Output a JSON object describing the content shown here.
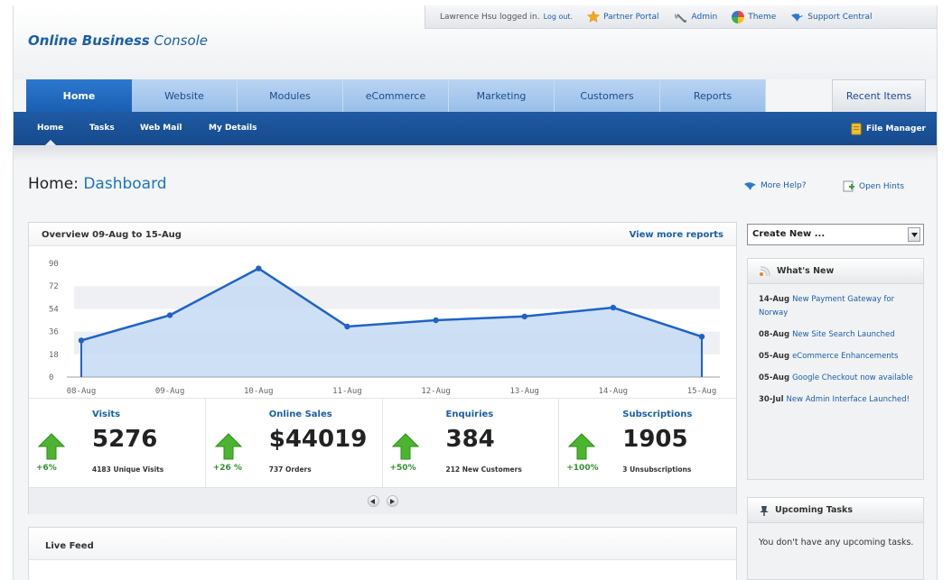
{
  "header": {
    "logo_bold": "Online Business",
    "logo_rest": "Console",
    "login_text": "Lawrence Hsu logged in.",
    "logout": "Log out.",
    "links": [
      {
        "label": "Partner Portal",
        "icon": "star-icon"
      },
      {
        "label": "Admin",
        "icon": "wrench-icon"
      },
      {
        "label": "Theme",
        "icon": "color-wheel-icon"
      },
      {
        "label": "Support Central",
        "icon": "support-bird-icon"
      }
    ]
  },
  "nav": {
    "tabs": [
      "Home",
      "Website",
      "Modules",
      "eCommerce",
      "Marketing",
      "Customers",
      "Reports"
    ],
    "active": "Home",
    "recent_items": "Recent Items"
  },
  "subnav": {
    "items": [
      "Home",
      "Tasks",
      "Web Mail",
      "My Details"
    ],
    "active": "Home",
    "file_manager": "File Manager"
  },
  "page": {
    "title_prefix": "Home:",
    "title": "Dashboard",
    "more_help": "More Help?",
    "open_hints": "Open Hints"
  },
  "overview": {
    "title": "Overview 09-Aug to 15-Aug",
    "more_link": "View more reports"
  },
  "chart_data": {
    "type": "area",
    "x": [
      "08-Aug",
      "09-Aug",
      "10-Aug",
      "11-Aug",
      "12-Aug",
      "13-Aug",
      "14-Aug",
      "15-Aug"
    ],
    "y_ticks": [
      0,
      18,
      36,
      54,
      72,
      90
    ],
    "ylim": [
      0,
      90
    ],
    "series": [
      {
        "values": [
          29,
          49,
          86,
          40,
          45,
          48,
          55,
          32
        ]
      }
    ],
    "grid": "alternating horizontal bands",
    "colors": {
      "line": "#1f63c7",
      "fill": "#c6dbf3"
    }
  },
  "stats": [
    {
      "label": "Visits",
      "value": "5276",
      "change": "+6%",
      "sub": "4183 Unique Visits"
    },
    {
      "label": "Online Sales",
      "value": "$44019",
      "change": "+26 %",
      "sub": "737 Orders"
    },
    {
      "label": "Enquiries",
      "value": "384",
      "change": "+50%",
      "sub": "212 New Customers"
    },
    {
      "label": "Subscriptions",
      "value": "1905",
      "change": "+100%",
      "sub": "3 Unsubscriptions"
    }
  ],
  "live_feed": {
    "title": "Live Feed"
  },
  "sidebar": {
    "create_new": "Create New ...",
    "whats_new": {
      "title": "What's New",
      "items": [
        {
          "date": "14-Aug",
          "text": "New Payment Gateway for Norway"
        },
        {
          "date": "08-Aug",
          "text": "New Site Search Launched"
        },
        {
          "date": "05-Aug",
          "text": "eCommerce Enhancements"
        },
        {
          "date": "05-Aug",
          "text": "Google Checkout now available"
        },
        {
          "date": "30-Jul",
          "text": "New Admin Interface Launched!"
        }
      ]
    },
    "tasks": {
      "title": "Upcoming Tasks",
      "empty": "You don't have any upcoming tasks."
    }
  },
  "colors": {
    "brand_blue": "#1b5fa6",
    "nav_active": "#1f6bc4",
    "subnav": "#1a5299",
    "positive": "#2f8f2f"
  }
}
